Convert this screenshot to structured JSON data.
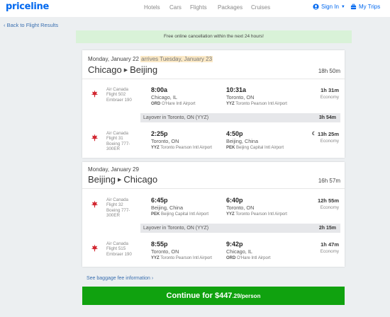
{
  "header": {
    "logo": "priceline",
    "nav": [
      "Hotels",
      "Cars",
      "Flights",
      "Packages",
      "Cruises"
    ],
    "sign_in": "Sign In",
    "my_trips": "My Trips"
  },
  "back_link": "Back to Flight Results",
  "notice": "Free online cancellation within the next 24 hours!",
  "outbound": {
    "date": "Monday, January 22",
    "arrives_note": "arrives Tuesday, January 23",
    "origin": "Chicago",
    "destination": "Beijing",
    "duration": "18h 50m",
    "segments": [
      {
        "airline": "Air Canada",
        "flight": "Flight 502",
        "aircraft": "Embraer 190",
        "dep_time": "8:00a",
        "dep_city": "Chicago, IL",
        "dep_code": "ORD",
        "dep_airport": "O'Hare Intl Airport",
        "arr_time": "10:31a",
        "arr_city": "Toronto, ON",
        "arr_code": "YYZ",
        "arr_airport": "Toronto Pearson Intl Airport",
        "duration": "1h 31m",
        "cabin": "Economy"
      },
      {
        "airline": "Air Canada",
        "flight": "Flight 31",
        "aircraft": "Boeing 777-300ER",
        "dep_time": "2:25p",
        "dep_city": "Toronto, ON",
        "dep_code": "YYZ",
        "dep_airport": "Toronto Pearson Intl Airport",
        "arr_time": "4:50p",
        "arr_city": "Beijing, China",
        "arr_code": "PEK",
        "arr_airport": "Beijing Capital Intl Airport",
        "duration": "13h 25m",
        "cabin": "Economy"
      }
    ],
    "layover": {
      "text": "Layover in Toronto, ON (YYZ)",
      "duration": "3h 54m"
    }
  },
  "return": {
    "date": "Monday, January 29",
    "origin": "Beijing",
    "destination": "Chicago",
    "duration": "16h 57m",
    "segments": [
      {
        "airline": "Air Canada",
        "flight": "Flight 32",
        "aircraft": "Boeing 777-300ER",
        "dep_time": "6:45p",
        "dep_city": "Beijing, China",
        "dep_code": "PEK",
        "dep_airport": "Beijing Capital Intl Airport",
        "arr_time": "6:40p",
        "arr_city": "Toronto, ON",
        "arr_code": "YYZ",
        "arr_airport": "Toronto Pearson Intl Airport",
        "duration": "12h 55m",
        "cabin": "Economy"
      },
      {
        "airline": "Air Canada",
        "flight": "Flight 515",
        "aircraft": "Embraer 190",
        "dep_time": "8:55p",
        "dep_city": "Toronto, ON",
        "dep_code": "YYZ",
        "dep_airport": "Toronto Pearson Intl Airport",
        "arr_time": "9:42p",
        "arr_city": "Chicago, IL",
        "arr_code": "ORD",
        "arr_airport": "O'Hare Intl Airport",
        "duration": "1h 47m",
        "cabin": "Economy"
      }
    ],
    "layover": {
      "text": "Layover in Toronto, ON (YYZ)",
      "duration": "2h 15m"
    }
  },
  "baggage_link": "See baggage fee information",
  "continue": {
    "label": "Continue for ",
    "price": "$447",
    "cents": ".29",
    "per": "/person"
  },
  "colors": {
    "brand": "#0068ef",
    "continue": "#10a20f",
    "notice": "#d9f2d8",
    "air_canada": "#d22630"
  }
}
